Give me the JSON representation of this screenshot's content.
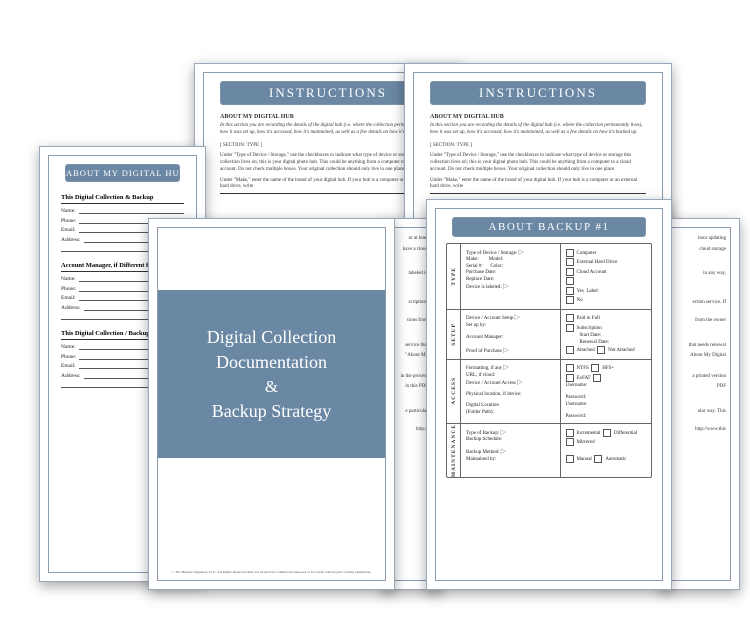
{
  "cover": {
    "line1": "Digital Collection",
    "line2": "Documentation",
    "line3": "&",
    "line4": "Backup Strategy",
    "copyright": "© The Heather Organizer, LLC. All Rights Reserved. May not be used for commercial purposes or for resale without prior written permission."
  },
  "instructions": {
    "title": "INSTRUCTIONS",
    "heading": "ABOUT MY DIGITAL HUB",
    "intro": "In this section you are recording the details of the digital hub (i.e. where the collection permanently lives), how it was set up, how it's accessed, how it's maintained, as well as a few details on how it's backed up.",
    "section_label": "[ SECTION: TYPE ]",
    "para2": "Under \"Type of Device / Storage,\" use the checkboxes to indicate what type of device or storage this collection lives on; this is your digital photo hub. This could be anything from a computer to a cloud account. Do not check multiple boxes. Your original collection should only live in one place.",
    "para3": "Under \"Make,\" enter the name of the brand of your digital hub. If your hub is a computer or an external hard drive, write",
    "frag_a": "or at least",
    "frag_b": "have a cloud",
    "frag_c": "labeled in",
    "frag_d": "scriptions",
    "frag_e": "tions from",
    "frag_f": "service that",
    "frag_g": "\"About My",
    "frag_h": "in the process",
    "frag_i": "in this PDF",
    "frag_j": "e particular",
    "frag_k": "http://",
    "frag2_a": "hour updating",
    "frag2_b": "cloud storage",
    "frag2_c": "in any way,",
    "frag2_d": "ection service. If",
    "frag2_e": "from the owner",
    "frag2_f": "that needs renewal",
    "frag2_g": "About My Digital",
    "frag2_h": "a printed version",
    "frag2_i": "PDF",
    "frag2_j": "ular way. This",
    "frag2_k": "http://www.this"
  },
  "about_hub": {
    "title": "ABOUT MY DIGITAL HUB",
    "section1": "This Digital Collection & Backup",
    "section2": "Account Manager, if Different from",
    "section3": "This Digital Collection / Backup S",
    "fields": {
      "name": "Name:",
      "phone": "Phone:",
      "email": "Email:",
      "address": "Address:"
    }
  },
  "backup": {
    "title": "ABOUT BACKUP #1",
    "tabs": {
      "type": "TYPE",
      "setup": "SETUP",
      "access": "ACCESS",
      "maint": "MAINTENANCE"
    },
    "type": {
      "l1": "Type of Device / Storage:",
      "l2a": "Make:",
      "l2b": "Model:",
      "l3a": "Serial #:",
      "l3b": "Color:",
      "l4": "Purchase Date:",
      "l5": "Replace Date:",
      "l6": "Device is labeled:",
      "opts": {
        "computer": "Computer",
        "ehd": "External Hard Drive",
        "cloud": "Cloud Account",
        "blank": "",
        "yes": "Yes",
        "label": "Label:",
        "no": "No"
      }
    },
    "setup": {
      "l1": "Device / Account Setup",
      "l2": "Set up by:",
      "l3": "Account Manager:",
      "l4": "Proof of Purchase",
      "opts": {
        "paid": "Paid in Full",
        "sub": "Subscription",
        "start": "Start Date:",
        "renew": "Renewal Date:",
        "attached": "Attached",
        "notatt": "Not Attached"
      }
    },
    "access": {
      "l1": "Formatting, if any",
      "l2": "URL, if cloud:",
      "l3": "Device / Account Access",
      "l4": "Physical location, if device:",
      "l5": "Digital Location",
      "l6": "(Folder Path):",
      "opts": {
        "ntfs": "NTFS",
        "hfs": "HFS+",
        "exfat": "ExFAT",
        "user": "Username:",
        "pass": "Password:"
      }
    },
    "maint": {
      "l1": "Type of Backup:",
      "l2": "Backup Schedule:",
      "l3": "Backup Method:",
      "l4": "Maintained by:",
      "opts": {
        "inc": "Incremental",
        "diff": "Differential",
        "mir": "Mirrored",
        "man": "Manual",
        "auto": "Automatic"
      }
    }
  }
}
